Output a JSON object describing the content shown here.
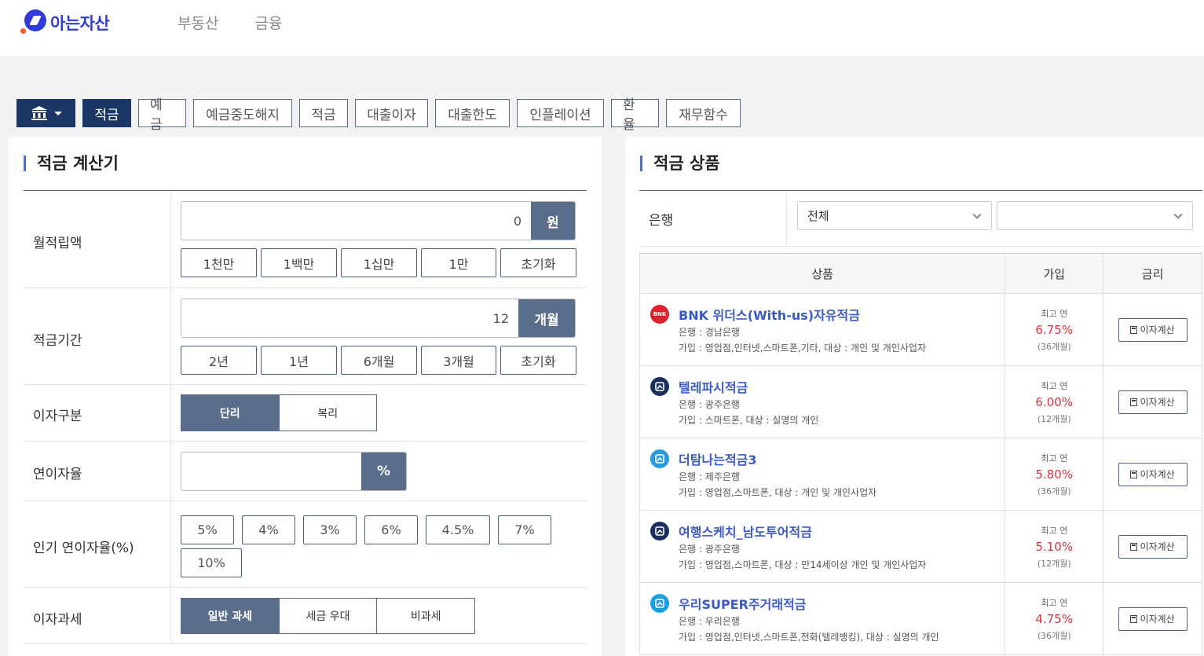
{
  "logo": {
    "text": "아는자산"
  },
  "topnav": [
    "부동산",
    "금융"
  ],
  "tabs": [
    "적금",
    "예금",
    "예금중도해지",
    "적금",
    "대출이자",
    "대출한도",
    "인플레이션",
    "환율",
    "재무함수"
  ],
  "calculator": {
    "title": "적금 계산기",
    "monthly": {
      "label": "월적립액",
      "value": "0",
      "unit": "원",
      "quick": [
        "1천만",
        "1백만",
        "1십만",
        "1만",
        "초기화"
      ]
    },
    "period": {
      "label": "적금기간",
      "value": "12",
      "unit": "개월",
      "quick": [
        "2년",
        "1년",
        "6개월",
        "3개월",
        "초기화"
      ]
    },
    "interest_type": {
      "label": "이자구분",
      "options": [
        "단리",
        "복리"
      ],
      "selected": "단리"
    },
    "annual_rate": {
      "label": "연이자율",
      "value": "",
      "unit": "%"
    },
    "popular_rates": {
      "label": "인기 연이자율(%)",
      "options": [
        "5%",
        "4%",
        "3%",
        "6%",
        "4.5%",
        "7%",
        "10%"
      ]
    },
    "tax": {
      "label": "이자과세",
      "options": [
        "일반 과세",
        "세금 우대",
        "비과세"
      ],
      "selected": "일반 과세"
    }
  },
  "products": {
    "title": "적금 상품",
    "bank_filter": {
      "label": "은행",
      "value": "전체",
      "value2": ""
    },
    "headers": [
      "상품",
      "가입",
      "금리"
    ],
    "rate_prefix": "최고 연",
    "calc_label": "이자계산",
    "items": [
      {
        "name": "BNK 위더스(With-us)자유적금",
        "bank": "은행 : 경남은행",
        "join": "가입 : 영업점,인터넷,스마트폰,기타, 대상 : 개인 및 개인사업자",
        "rate": "6.75%",
        "term": "(36개월)",
        "logo_text": "BNK",
        "logo_color": "#d9232d"
      },
      {
        "name": "텔레파시적금",
        "bank": "은행 : 광주은행",
        "join": "가입 : 스마트폰, 대상 : 실명의 개인",
        "rate": "6.00%",
        "term": "(12개월)",
        "logo_text": "",
        "logo_color": "#1b2f5e"
      },
      {
        "name": "더탐나는적금3",
        "bank": "은행 : 제주은행",
        "join": "가입 : 영업점,스마트폰, 대상 : 개인 및 개인사업자",
        "rate": "5.80%",
        "term": "(36개월)",
        "logo_text": "",
        "logo_color": "#2b9be0"
      },
      {
        "name": "여행스케치_남도투어적금",
        "bank": "은행 : 광주은행",
        "join": "가입 : 영업점,스마트폰, 대상 : 만14세이상 개인 및 개인사업자",
        "rate": "5.10%",
        "term": "(12개월)",
        "logo_text": "",
        "logo_color": "#1b2f5e"
      },
      {
        "name": "우리SUPER주거래적금",
        "bank": "은행 : 우리은행",
        "join": "가입 : 영업점,인터넷,스마트폰,전화(텔레뱅킹), 대상 : 실명의 개인",
        "rate": "4.75%",
        "term": "(36개월)",
        "logo_text": "",
        "logo_color": "#1a9ee8"
      }
    ]
  }
}
